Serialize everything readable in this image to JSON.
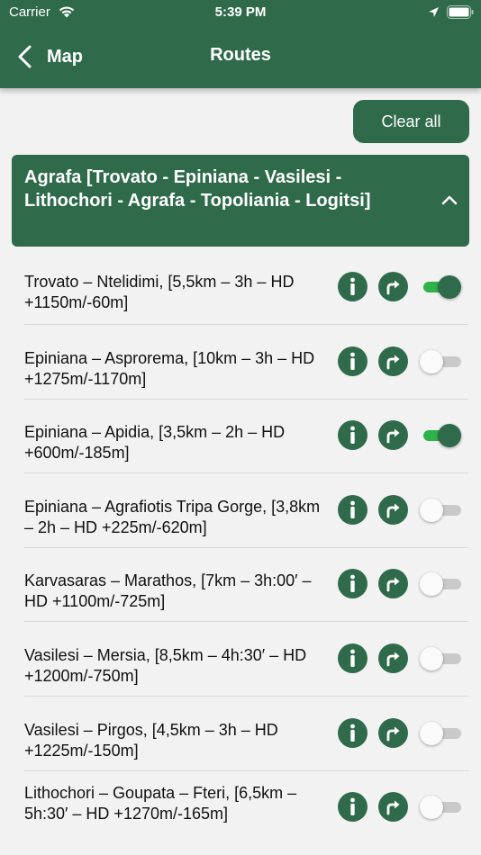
{
  "status_bar": {
    "carrier": "Carrier",
    "time": "5:39 PM",
    "icons": [
      "wifi-icon",
      "location-icon",
      "battery-icon"
    ]
  },
  "nav": {
    "back_label": "Map",
    "title": "Routes"
  },
  "clear_all_label": "Clear all",
  "section": {
    "title": "Agrafa [Trovato - Epiniana - Vasilesi - Lithochori - Agrafa - Topoliania - Logitsi]",
    "expanded": true
  },
  "routes": [
    {
      "label": "Trovato – Ntelidimi, [5,5km – 3h – HD +1150m/-60m]",
      "enabled": true
    },
    {
      "label": "Epiniana – Asprorema, [10km – 3h – HD +1275m/-1170m]",
      "enabled": false
    },
    {
      "label": "Epiniana – Apidia, [3,5km – 2h – HD +600m/-185m]",
      "enabled": true
    },
    {
      "label": "Epiniana – Agrafiotis Tripa Gorge, [3,8km – 2h – HD +225m/-620m]",
      "enabled": false
    },
    {
      "label": "Karvasaras – Marathos, [7km – 3h:00′ – HD +1100m/-725m]",
      "enabled": false
    },
    {
      "label": "Vasilesi – Mersia, [8,5km – 4h:30′ – HD +1200m/-750m]",
      "enabled": false
    },
    {
      "label": "Vasilesi – Pirgos, [4,5km – 3h – HD +1225m/-150m]",
      "enabled": false
    },
    {
      "label": "Lithochori – Goupata – Fteri, [6,5km – 5h:30′ – HD +1270m/-165m]",
      "enabled": false
    }
  ],
  "colors": {
    "brand": "#2f6b4b",
    "toggle_on": "#2db34a",
    "background": "#f2f2f2"
  }
}
